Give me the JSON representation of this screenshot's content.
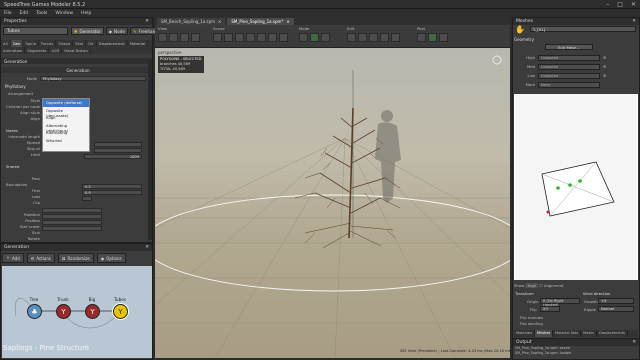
{
  "app": {
    "title": "SpeedTree Games Modeler 8.5.2",
    "menu": [
      "File",
      "Edit",
      "Tools",
      "Window",
      "Help"
    ]
  },
  "left": {
    "panel_title": "Properties",
    "species": "Tubes",
    "mode_buttons": [
      "Generator",
      "Node",
      "Freehand"
    ],
    "tabs": [
      "All",
      "Gen",
      "Spine",
      "Forces",
      "Shape",
      "Skin",
      "UV",
      "Displacement",
      "Material",
      "Animation",
      "Segments",
      "LOD",
      "Hand Drawn"
    ],
    "section_header": "Generation",
    "subsection": "Generation",
    "mode_label": "Mode",
    "mode_value": "Phyllotaxy",
    "phyllotaxy_label": "Phyllotaxy",
    "arrangement_label": "Arrangement",
    "labels": [
      "Style",
      "Children per node",
      "Align style",
      "Align",
      "",
      "Nodes",
      "Internode length",
      "Spread",
      "Skip at",
      "Limit",
      "Shared",
      "",
      "Pass",
      "Boundaries",
      "First",
      "Last",
      "Clip",
      "",
      "Rotation",
      "Position",
      "Size scaler",
      "Sink",
      "Rotate"
    ],
    "limit_value": "1000",
    "first_value": "0.2",
    "last_value": "0.9",
    "dropdown": [
      "Opposite (deflorse)",
      "Opposite (decussate)",
      "Align",
      "Alternating (distichous)",
      "Alternating",
      "Whorled"
    ],
    "dropdown_selected": 0
  },
  "generation": {
    "title": "Generation",
    "buttons": [
      "Add",
      "Actions",
      "Randomize",
      "Options"
    ],
    "nodes": [
      {
        "label": "Tree",
        "color": "#5b8fc0"
      },
      {
        "label": "Trunk",
        "color": "#9a2a2a"
      },
      {
        "label": "Big",
        "color": "#9a2a2a"
      },
      {
        "label": "Tubes",
        "color": "#e5c400"
      }
    ],
    "footer": "Saplings - Pine Structure"
  },
  "viewport": {
    "tabs": [
      "SM_Beech_Sapling_1a.spm",
      "SM_Pine_Sapling_1a.spm*"
    ],
    "toolbar_groups": [
      "View",
      "Scene",
      "Mode",
      "Edit",
      "Post"
    ],
    "label": "perspective",
    "stats": [
      "POLYGONS - SELECTED",
      "branches  40,569",
      "leaves    0",
      "TOTAL     40,569"
    ],
    "status": "281 lines (Prevalent) ; Last Compute: 4.43 ms (Max 24.10 ms)"
  },
  "right": {
    "title": "Meshes",
    "mesh_name": "1_[01]",
    "geometry": "Geometry",
    "edit_mesh": "Edit Mesh...",
    "lod": [
      {
        "label": "High",
        "value": "Unloaded"
      },
      {
        "label": "Med",
        "value": "Unloaded"
      },
      {
        "label": "Low",
        "value": "Unloaded"
      },
      {
        "label": "More",
        "value": "None"
      }
    ],
    "show_label": "Show",
    "show_value": "High",
    "alignment": "Alignment",
    "transform": "Transform",
    "wind": "Wind direction",
    "origin_label": "Origin",
    "origin_value": "0 (Up Right Handed)",
    "flip_label": "Flip",
    "flip_value": "X-Y",
    "flip_normals": "Flip normals",
    "flip_winding": "Flip winding",
    "growth_label": "Growth",
    "growth_value": "+X",
    "ripple_label": "Ripple",
    "ripple_value": "Normal",
    "tabs": [
      "Materials",
      "Meshes",
      "Material Sets",
      "Masks",
      "Displacements"
    ],
    "output_title": "Output",
    "output_lines": [
      "SM_Pine_Sapling_1a.spm: saved",
      "SM_Pine_Sapling_1a.spm: loaded"
    ]
  },
  "colors": {
    "selection": "#3a78c8",
    "tree_node": "#5b8fc0",
    "branch_node": "#9a2a2a",
    "leaf_node": "#e5c400",
    "viewport_ground": "#b2a992"
  }
}
